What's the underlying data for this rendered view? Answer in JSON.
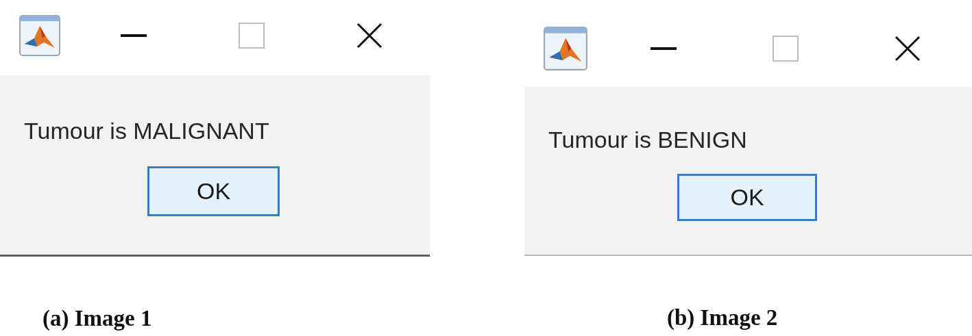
{
  "figures": [
    {
      "window": {
        "message": "Tumour is MALIGNANT",
        "button": "OK",
        "button_focused": true
      },
      "caption": "(a) Image 1"
    },
    {
      "window": {
        "message": "Tumour is BENIGN",
        "button": "OK",
        "button_focused": true
      },
      "caption": "(b) Image 2"
    }
  ]
}
